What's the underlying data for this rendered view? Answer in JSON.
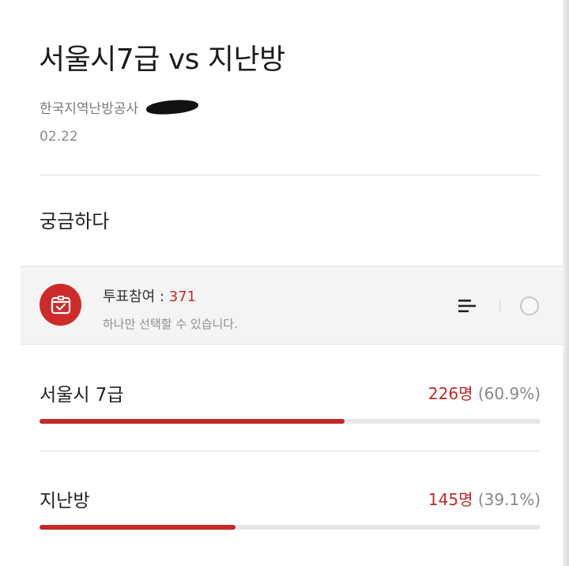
{
  "post": {
    "title": "서울시7급 vs 지난방",
    "author": "한국지역난방공사",
    "date": "02.22",
    "body": "궁금하다"
  },
  "poll": {
    "label": "투표참여",
    "separator": " : ",
    "count": "371",
    "subtitle": "하나만 선택할 수 있습니다.",
    "icons": [
      "ballot-box-icon",
      "sort-icon",
      "radio-icon"
    ],
    "options": [
      {
        "name": "서울시 7급",
        "votes": "226명",
        "percent_text": "(60.9%)",
        "fraction": 0.609
      },
      {
        "name": "지난방",
        "votes": "145명",
        "percent_text": "(39.1%)",
        "fraction": 0.391
      }
    ]
  },
  "colors": {
    "accent": "#c42828",
    "track": "#e6e6e6",
    "muted": "#888888"
  }
}
